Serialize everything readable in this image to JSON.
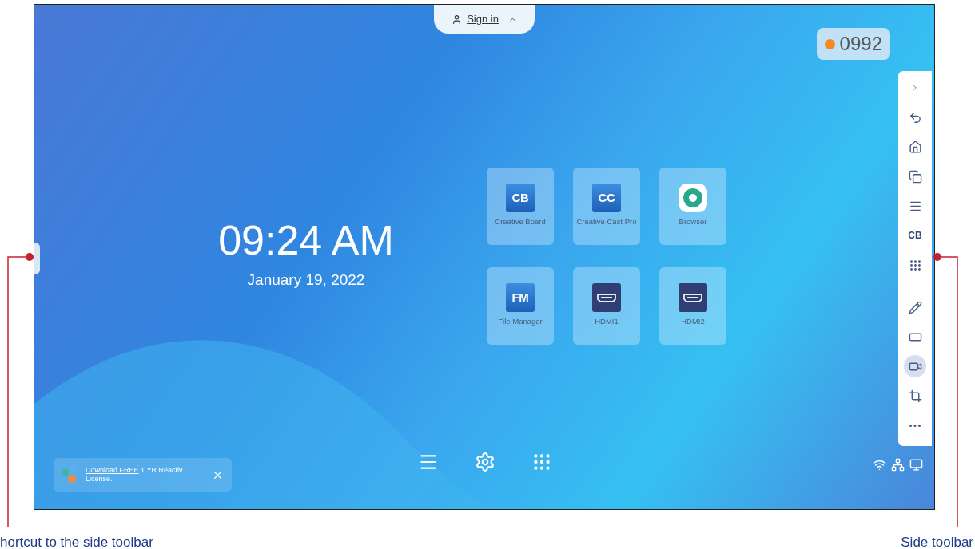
{
  "screen": {
    "sign_in": {
      "label": "Sign in"
    },
    "code_badge": {
      "code": "0992"
    },
    "clock": {
      "time": "09:24 AM",
      "date": "January 19, 2022"
    },
    "apps": [
      {
        "label": "Creative Board",
        "kind": "logo",
        "logo_text": "CB"
      },
      {
        "label": "Creative Cast Pro",
        "kind": "logo",
        "logo_text": "CC"
      },
      {
        "label": "Browser",
        "kind": "browser"
      },
      {
        "label": "File Manager",
        "kind": "logo",
        "logo_text": "FM"
      },
      {
        "label": "HDMI1",
        "kind": "hdmi"
      },
      {
        "label": "HDMI2",
        "kind": "hdmi"
      }
    ],
    "side_toolbar": {
      "items": [
        {
          "kind": "collapse",
          "selected": false
        },
        {
          "kind": "back",
          "selected": false
        },
        {
          "kind": "home",
          "selected": false
        },
        {
          "kind": "windows",
          "selected": false
        },
        {
          "kind": "menu",
          "selected": false
        },
        {
          "kind": "text",
          "text": "CB",
          "selected": false
        },
        {
          "kind": "apps",
          "selected": false
        },
        {
          "kind": "divider"
        },
        {
          "kind": "pen",
          "selected": false
        },
        {
          "kind": "ratio",
          "selected": false
        },
        {
          "kind": "camera",
          "selected": true
        },
        {
          "kind": "crop",
          "selected": false
        },
        {
          "kind": "more",
          "selected": false
        }
      ]
    },
    "dock": [
      {
        "kind": "menu"
      },
      {
        "kind": "settings"
      },
      {
        "kind": "apps"
      }
    ],
    "notification": {
      "link": "Download FREE",
      "text": "1 YR Reactiv License."
    },
    "status_icons": [
      {
        "kind": "wifi"
      },
      {
        "kind": "network"
      },
      {
        "kind": "device"
      }
    ]
  },
  "annotations": [
    {
      "label": "hortcut to the side toolbar"
    },
    {
      "label": "Side toolbar"
    }
  ]
}
